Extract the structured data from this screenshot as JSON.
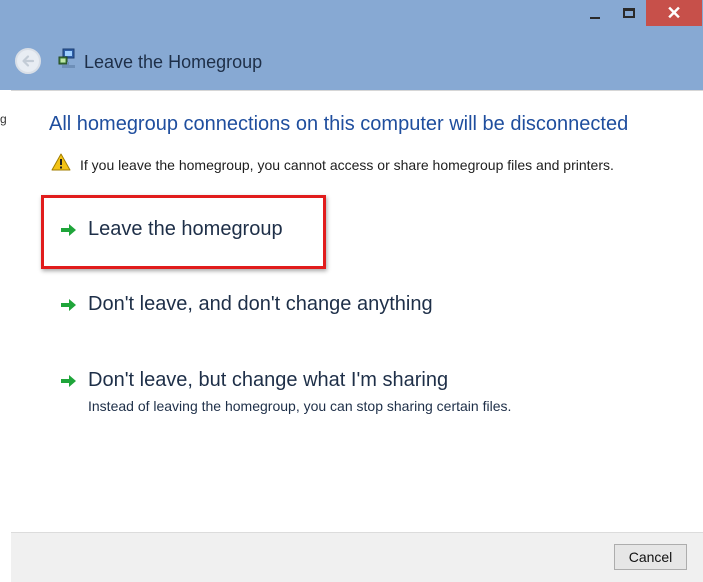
{
  "window": {
    "title": "Leave the Homegroup",
    "icons": {
      "back": "back-arrow-icon",
      "app": "homegroup-icon",
      "minimize": "minimize-icon",
      "maximize": "maximize-icon",
      "close": "close-icon"
    }
  },
  "left_artifact": "g",
  "main": {
    "heading": "All homegroup connections on this computer will be disconnected",
    "warning": {
      "icon": "warning-icon",
      "text": "If you leave the homegroup, you cannot access or share homegroup files and printers."
    },
    "options": [
      {
        "label": "Leave the homegroup",
        "icon": "green-arrow-icon",
        "highlighted": true
      },
      {
        "label": "Don't leave, and don't change anything",
        "icon": "green-arrow-icon"
      },
      {
        "label": "Don't leave, but change what I'm sharing",
        "description": "Instead of leaving the homegroup, you can stop sharing certain files.",
        "icon": "green-arrow-icon"
      }
    ]
  },
  "footer": {
    "cancel_label": "Cancel"
  },
  "colors": {
    "chrome": "#87a9d3",
    "close": "#c7504a",
    "heading": "#1f4e9e",
    "highlight": "#e11c1c",
    "arrow": "#1fa53a"
  }
}
